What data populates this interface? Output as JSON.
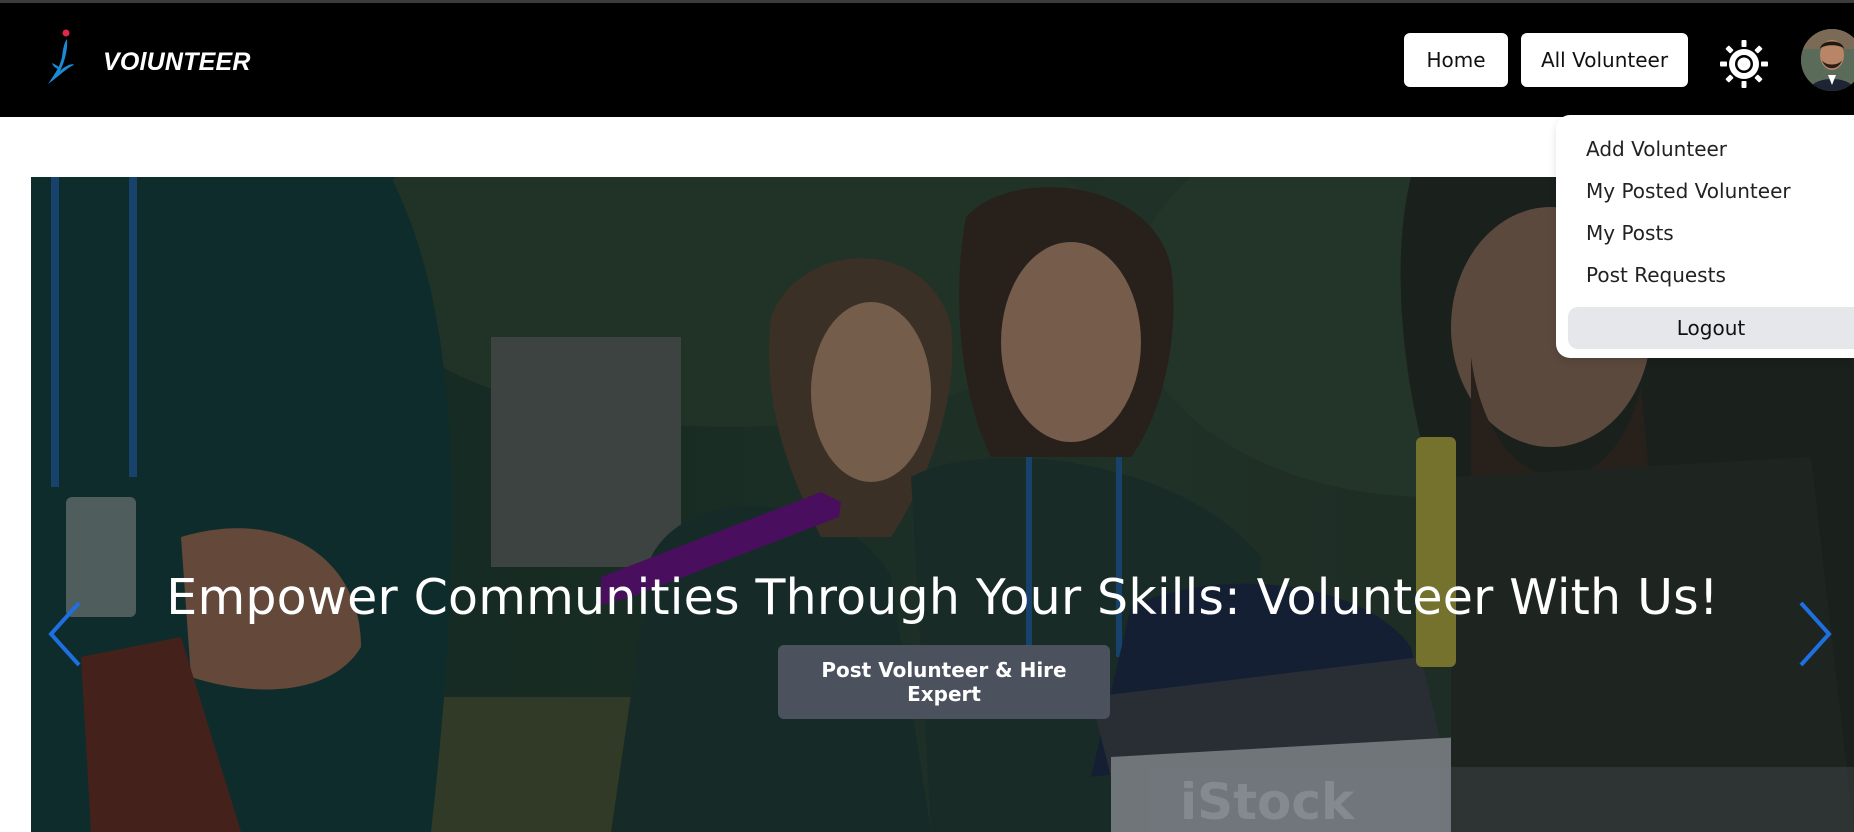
{
  "navbar": {
    "brand": "VOlUNTEER",
    "home_label": "Home",
    "all_volunteer_label": "All Volunteer",
    "theme_icon": "sun-icon"
  },
  "dropdown": {
    "items": [
      "Add Volunteer",
      "My Posted Volunteer",
      "My Posts",
      "Post Requests"
    ],
    "logout_label": "Logout"
  },
  "hero": {
    "title": "Empower Communities Through Your Skills: Volunteer With Us!",
    "cta_label": "Post Volunteer & Hire Expert",
    "watermark": "iStock"
  },
  "colors": {
    "navbar_bg": "#000000",
    "arrow": "#1e6fe0",
    "cta_bg": "#4b525e",
    "logo_blue": "#1a8ad6",
    "logo_accent": "#e2264d"
  }
}
